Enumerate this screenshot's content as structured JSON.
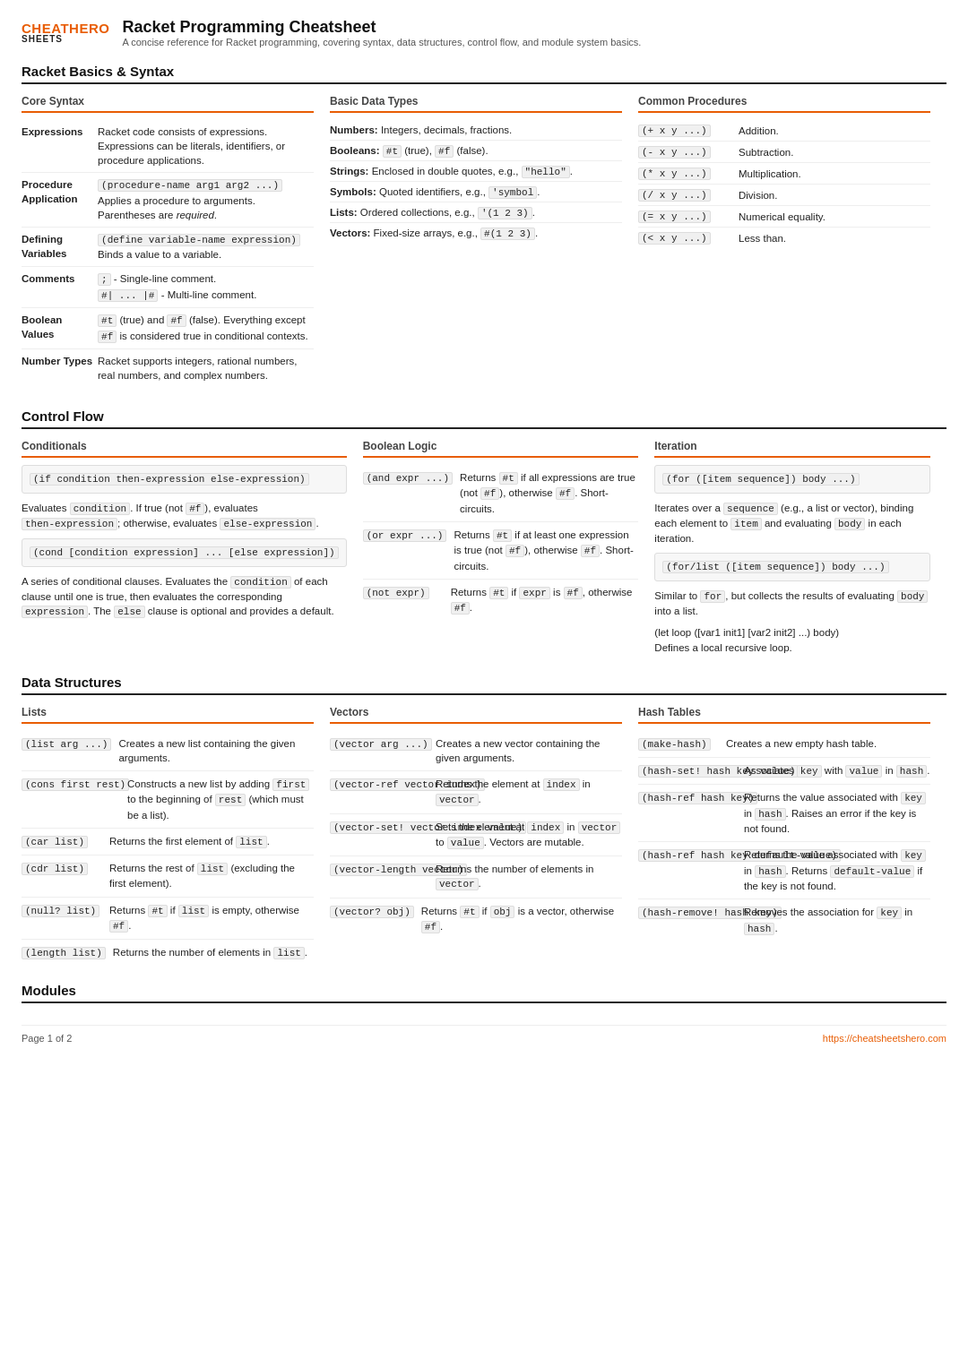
{
  "header": {
    "logo_top": "CHEAT",
    "logo_top_accent": "HERO",
    "logo_bottom": "SHEETS",
    "title": "Racket Programming Cheatsheet",
    "subtitle": "A concise reference for Racket programming, covering syntax, data structures, control flow, and module system basics."
  },
  "sections": {
    "racket_basics": "Racket Basics & Syntax",
    "control_flow": "Control Flow",
    "data_structures": "Data Structures",
    "modules": "Modules"
  },
  "core_syntax": {
    "header": "Core Syntax",
    "rows": [
      {
        "label": "Expressions",
        "desc": "Racket code consists of expressions. Expressions can be literals, identifiers, or procedure applications."
      },
      {
        "label": "Procedure Application",
        "code": "(procedure-name arg1 arg2 ...)",
        "desc": "Applies a procedure to arguments. Parentheses are required."
      },
      {
        "label": "Defining Variables",
        "code": "(define variable-name expression)",
        "desc": "Binds a value to a variable."
      },
      {
        "label": "Comments",
        "code1": ";",
        "desc1": "- Single-line comment.",
        "code2": "#| ... |#",
        "desc2": "- Multi-line comment."
      },
      {
        "label": "Boolean Values",
        "code1": "#t",
        "desc1": "(true) and",
        "code2": "#f",
        "desc2": "(false). Everything except #f is considered true in conditional contexts."
      },
      {
        "label": "Number Types",
        "desc": "Racket supports integers, rational numbers, real numbers, and complex numbers."
      }
    ]
  },
  "basic_data_types": {
    "header": "Basic Data Types",
    "rows": [
      {
        "label": "Numbers:",
        "desc": "Integers, decimals, fractions."
      },
      {
        "label": "Booleans:",
        "code1": "#t",
        "desc1": "(true),",
        "code2": "#f",
        "desc2": "(false)."
      },
      {
        "label": "Strings:",
        "desc": "Enclosed in double quotes, e.g., \"hello\"."
      },
      {
        "label": "Symbols:",
        "desc": "Quoted identifiers, e.g., 'symbol."
      },
      {
        "label": "Lists:",
        "desc": "Ordered collections, e.g., '(1 2 3)."
      },
      {
        "label": "Vectors:",
        "desc": "Fixed-size arrays, e.g., #(1 2 3)."
      }
    ]
  },
  "common_procedures": {
    "header": "Common Procedures",
    "rows": [
      {
        "code": "(+ x y ...)",
        "desc": "Addition."
      },
      {
        "code": "(- x y ...)",
        "desc": "Subtraction."
      },
      {
        "code": "(* x y ...)",
        "desc": "Multiplication."
      },
      {
        "code": "(/ x y ...)",
        "desc": "Division."
      },
      {
        "code": "(= x y ...)",
        "desc": "Numerical equality."
      },
      {
        "code": "(< x y ...)",
        "desc": "Less than."
      }
    ]
  },
  "conditionals": {
    "header": "Conditionals",
    "blocks": [
      {
        "code": "(if condition then-expression else-expression)",
        "desc": "Evaluates condition. If true (not #f), evaluates then-expression; otherwise, evaluates else-expression."
      },
      {
        "code": "(cond [condition expression] ... [else expression])",
        "desc": "A series of conditional clauses. Evaluates the condition of each clause until one is true, then evaluates the corresponding expression. The else clause is optional and provides a default."
      }
    ]
  },
  "boolean_logic": {
    "header": "Boolean Logic",
    "rows": [
      {
        "code": "(and expr ...)",
        "desc": "Returns #t if all expressions are true (not #f), otherwise #f. Short-circuits."
      },
      {
        "code": "(or expr ...)",
        "desc": "Returns #t if at least one expression is true (not #f), otherwise #f. Short-circuits."
      },
      {
        "code": "(not expr)",
        "desc": "Returns #t if expr is #f, otherwise #f."
      }
    ]
  },
  "iteration": {
    "header": "Iteration",
    "blocks": [
      {
        "code": "(for ([item sequence]) body ...)",
        "desc": "Iterates over a sequence (e.g., a list or vector), binding each element to item and evaluating body in each iteration."
      },
      {
        "code": "(for/list ([item sequence]) body ...)",
        "desc": "Similar to for, but collects the results of evaluating body into a list."
      },
      {
        "code": "(let loop ([var1 init1] [var2 init2] ...) body)",
        "desc": "Defines a local recursive loop."
      }
    ]
  },
  "lists": {
    "header": "Lists",
    "rows": [
      {
        "code": "(list arg ...)",
        "desc": "Creates a new list containing the given arguments."
      },
      {
        "code": "(cons first rest)",
        "desc": "Constructs a new list by adding first to the beginning of rest (which must be a list)."
      },
      {
        "code": "(car list)",
        "desc": "Returns the first element of list."
      },
      {
        "code": "(cdr list)",
        "desc": "Returns the rest of list (excluding the first element)."
      },
      {
        "code": "(null? list)",
        "desc": "Returns #t if list is empty, otherwise #f."
      },
      {
        "code": "(length list)",
        "desc": "Returns the number of elements in list."
      }
    ]
  },
  "vectors": {
    "header": "Vectors",
    "rows": [
      {
        "code": "(vector arg ...)",
        "desc": "Creates a new vector containing the given arguments."
      },
      {
        "code": "(vector-ref vector index)",
        "desc": "Returns the element at index in vector."
      },
      {
        "code": "(vector-set! vector index value)",
        "desc": "Sets the element at index in vector to value. Vectors are mutable."
      },
      {
        "code": "(vector-length vector)",
        "desc": "Returns the number of elements in vector."
      },
      {
        "code": "(vector? obj)",
        "desc": "Returns #t if obj is a vector, otherwise #f."
      }
    ]
  },
  "hash_tables": {
    "header": "Hash Tables",
    "rows": [
      {
        "code": "(make-hash)",
        "desc": "Creates a new empty hash table."
      },
      {
        "code": "(hash-set! hash key value)",
        "desc": "Associates key with value in hash."
      },
      {
        "code": "(hash-ref hash key)",
        "desc": "Returns the value associated with key in hash. Raises an error if the key is not found."
      },
      {
        "code": "(hash-ref hash key default-value)",
        "desc": "Returns the value associated with key in hash. Returns default-value if the key is not found."
      },
      {
        "code": "(hash-remove! hash key)",
        "desc": "Removes the association for key in hash."
      }
    ]
  },
  "footer": {
    "page": "Page 1 of 2",
    "url": "https://cheatsheetshero.com"
  }
}
